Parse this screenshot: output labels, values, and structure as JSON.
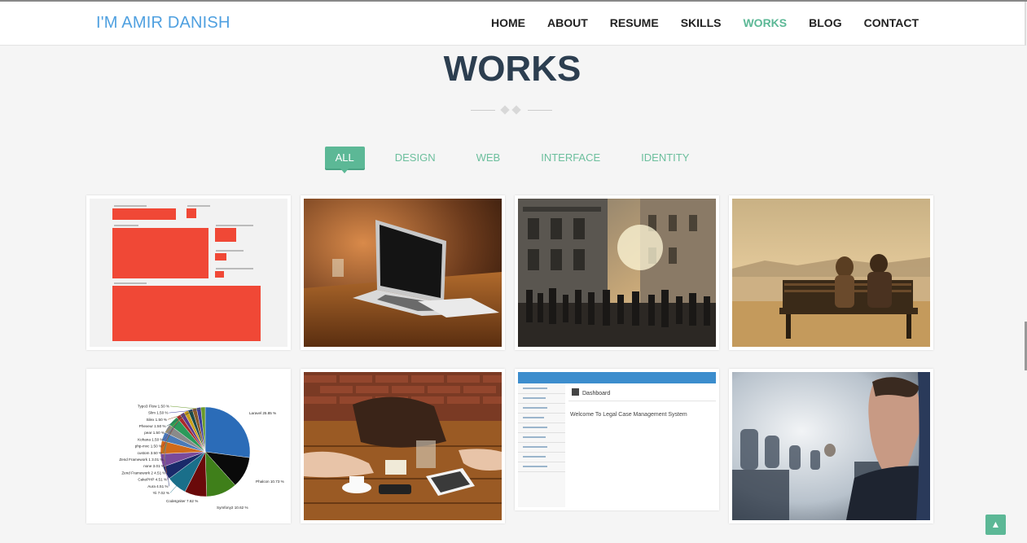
{
  "header": {
    "brand": "I'M AMIR DANISH",
    "nav": [
      "HOME",
      "ABOUT",
      "RESUME",
      "SKILLS",
      "WORKS",
      "BLOG",
      "CONTACT"
    ],
    "active_nav": "WORKS"
  },
  "section": {
    "title": "WORKS",
    "filters": [
      "ALL",
      "DESIGN",
      "WEB",
      "INTERFACE",
      "IDENTITY"
    ],
    "active_filter": "ALL"
  },
  "works": [
    {
      "kind": "treemap-chart"
    },
    {
      "kind": "laptop-photo"
    },
    {
      "kind": "city-street-photo"
    },
    {
      "kind": "bench-couple-photo"
    },
    {
      "kind": "framework-pie-chart",
      "pie_labels": [
        "Laravel 25.85 %",
        "Phalcon 10.73 %",
        "Symfony2 10.62 %",
        "CodeIgniter 7.62 %",
        "Yii 7.02 %",
        "Aura 4.51 %",
        "CakePHP 4.51 %",
        "Zend Framework 2 4.51 %",
        "none 3.01 %",
        "Zend Framework 1 3.01 %",
        "custom 3.50 %",
        "php-mvc 1.50 %",
        "Kohana 1.50 %",
        "pear 1.50 %",
        "Phexeur 1.50 %",
        "Silex 1.50 %",
        "Slim 1.50 %",
        "Typo3 Flow 1.50 %"
      ]
    },
    {
      "kind": "coffee-table-photo"
    },
    {
      "kind": "dashboard-screenshot",
      "dashboard_heading": "Dashboard",
      "dashboard_welcome": "Welcome To Legal Case Management System"
    },
    {
      "kind": "airplane-photo"
    }
  ],
  "colors": {
    "accent": "#5cb896",
    "brand": "#4fa0e0",
    "title": "#2c3e50",
    "chart_red": "#f04836"
  },
  "icons": {
    "back_to_top": "chevron-up-icon"
  }
}
